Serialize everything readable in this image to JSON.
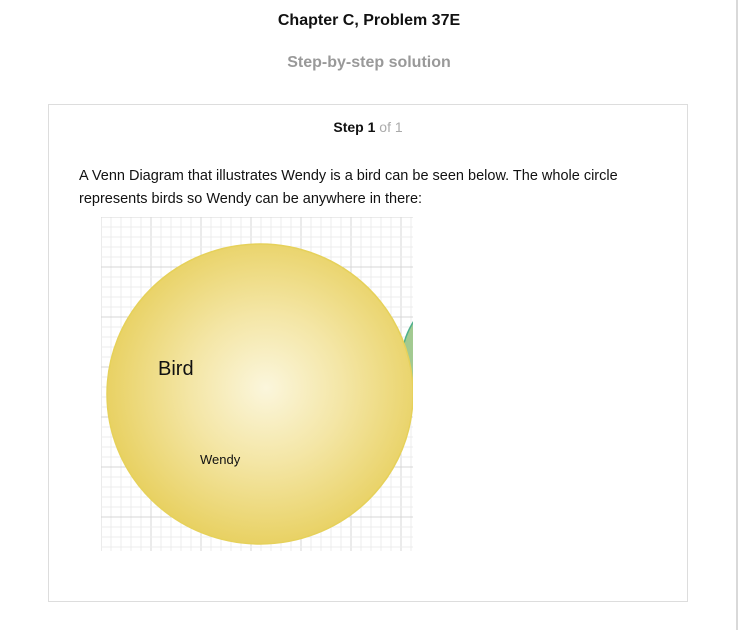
{
  "header": {
    "title": "Chapter C, Problem 37E",
    "subtitle": "Step-by-step solution"
  },
  "step": {
    "label": "Step",
    "number": "1",
    "of_text": "of 1",
    "text": "A Venn Diagram that illustrates Wendy is a bird can be seen below. The whole circle represents birds so Wendy can be anywhere in there:"
  },
  "diagram": {
    "set_label": "Bird",
    "element_label": "Wendy",
    "colors": {
      "set_fill": "#ecd672",
      "set_stroke": "#e6d15a",
      "partial_fill": "#b7cf8e",
      "partial_stroke": "#4fb08c",
      "grid_minor": "#ececec",
      "grid_major": "#d7d7d7"
    }
  }
}
